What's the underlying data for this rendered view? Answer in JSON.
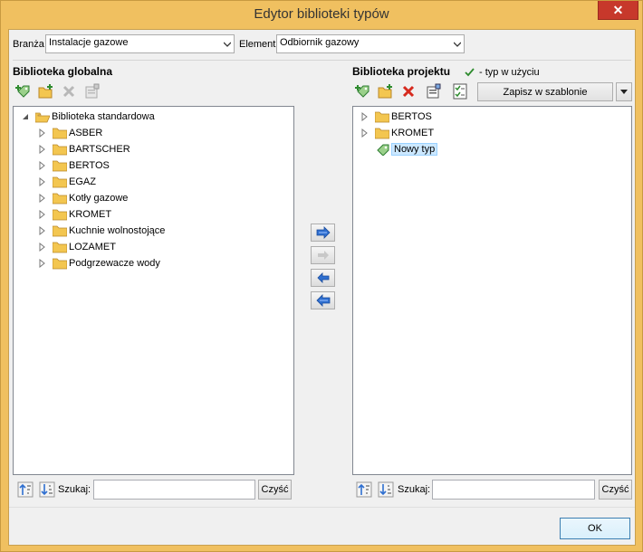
{
  "window": {
    "title": "Edytor biblioteki typów",
    "close_glyph": "✕"
  },
  "filters": {
    "branza_label": "Branża",
    "branza_value": "Instalacje gazowe",
    "element_label": "Element",
    "element_value": "Odbiornik gazowy"
  },
  "global": {
    "title": "Biblioteka globalna",
    "root": "Biblioteka standardowa",
    "items": [
      "ASBER",
      "BARTSCHER",
      "BERTOS",
      "EGAZ",
      "Kotły gazowe",
      "KROMET",
      "Kuchnie wolnostojące",
      "LOZAMET",
      "Podgrzewacze wody"
    ]
  },
  "project": {
    "title": "Biblioteka projektu",
    "legend": "- typ w użyciu",
    "save_label": "Zapisz w szablonie",
    "folders": [
      "BERTOS",
      "KROMET"
    ],
    "new_item": "Nowy typ"
  },
  "search": {
    "label": "Szukaj:",
    "clear_label": "Czyść"
  },
  "footer": {
    "ok_label": "OK"
  },
  "colors": {
    "frame": "#f0c060",
    "close": "#c7382b",
    "folder": "#f3c650",
    "arrow": "#2f6fd0",
    "delete": "#d62a1e",
    "check": "#2e8b2e"
  }
}
